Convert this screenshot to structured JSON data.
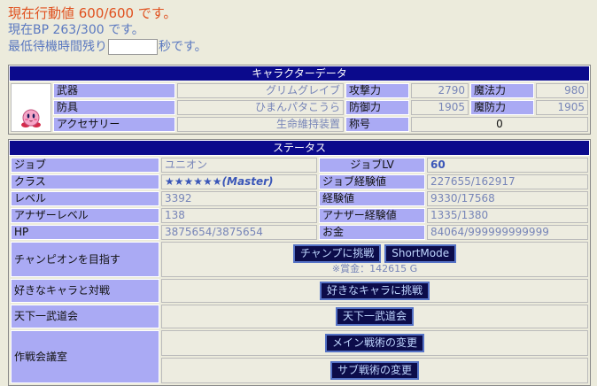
{
  "status": {
    "action_line": "現在行動値 600/600 です。",
    "bp_line": "現在BP 263/300 です。",
    "wait_prefix": "最低待機時間残り",
    "wait_value": "",
    "wait_suffix": "秒です。"
  },
  "character": {
    "header": "キャラクターデータ",
    "weapon_label": "武器",
    "weapon_value": "グリムグレイブ",
    "armor_label": "防具",
    "armor_value": "ひまんパタこうら",
    "accessory_label": "アクセサリー",
    "accessory_value": "生命維持装置",
    "atk_label": "攻撃力",
    "atk_value": "2790",
    "matk_label": "魔法力",
    "matk_value": "980",
    "def_label": "防御力",
    "def_value": "1905",
    "mdef_label": "魔防力",
    "mdef_value": "1905",
    "title_label": "称号",
    "title_value": "0"
  },
  "stats": {
    "header": "ステータス",
    "job_label": "ジョブ",
    "job_value": "ユニオン",
    "joblv_label": "ジョブLV",
    "joblv_value": "60",
    "class_label": "クラス",
    "class_value": "★★★★★★(Master)",
    "jobexp_label": "ジョブ経験値",
    "jobexp_value": "227655/162917",
    "level_label": "レベル",
    "level_value": "3392",
    "exp_label": "経験値",
    "exp_value": "9330/17568",
    "another_label": "アナザーレベル",
    "another_value": "138",
    "anotherexp_label": "アナザー経験値",
    "anotherexp_value": "1335/1380",
    "hp_label": "HP",
    "hp_value": "3875654/3875654",
    "gold_label": "お金",
    "gold_value": "84064/999999999999"
  },
  "actions": {
    "champion_label": "チャンピオンを目指す",
    "champion_button": "チャンプに挑戦",
    "shortmode_button": "ShortMode",
    "prize_note": "※賞金：142615 G",
    "favorite_label": "好きなキャラと対戦",
    "favorite_button": "好きなキャラに挑戦",
    "tournament_label": "天下一武道会",
    "tournament_button": "天下一武道会",
    "strategy_label": "作戦会議室",
    "main_strategy_button": "メイン戦術の変更",
    "sub_strategy_button": "サブ戦術の変更"
  },
  "icons": {
    "avatar": "pink-round-character-icon"
  }
}
